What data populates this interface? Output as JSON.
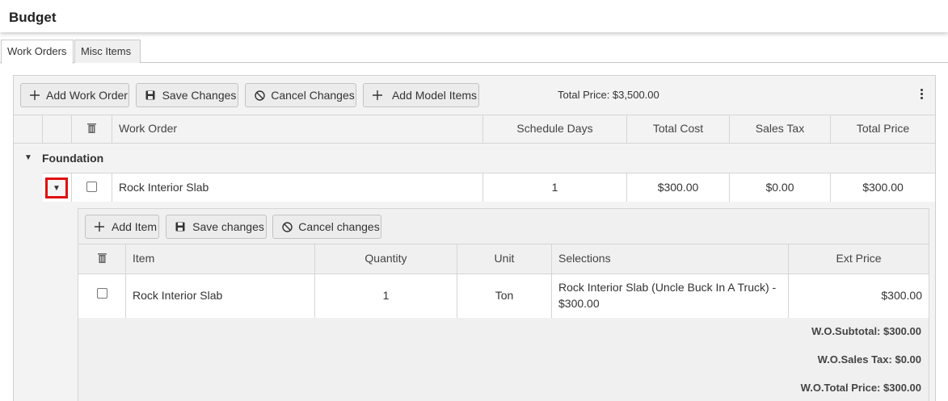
{
  "header": {
    "title": "Budget"
  },
  "tabs": [
    {
      "label": "Work Orders",
      "active": true
    },
    {
      "label": "Misc Items",
      "active": false
    }
  ],
  "toolbar": {
    "add_work_order": "Add Work Order",
    "save_changes": "Save Changes",
    "cancel_changes": "Cancel Changes",
    "add_model_items": "Add Model Items",
    "total_price": "Total Price: $3,500.00"
  },
  "columns": {
    "work_order": "Work Order",
    "schedule_days": "Schedule Days",
    "total_cost": "Total Cost",
    "sales_tax": "Sales Tax",
    "total_price": "Total Price"
  },
  "group": {
    "name": "Foundation"
  },
  "work_order_row": {
    "name": "Rock Interior Slab",
    "schedule_days": "1",
    "total_cost": "$300.00",
    "sales_tax": "$0.00",
    "total_price": "$300.00"
  },
  "detail": {
    "toolbar": {
      "add_item": "Add Item",
      "save_changes": "Save changes",
      "cancel_changes": "Cancel changes"
    },
    "columns": {
      "item": "Item",
      "quantity": "Quantity",
      "unit": "Unit",
      "selections": "Selections",
      "ext_price": "Ext Price"
    },
    "row": {
      "item": "Rock Interior Slab",
      "quantity": "1",
      "unit": "Ton",
      "selections_line1": "Rock Interior Slab (Uncle Buck In A Truck) -",
      "selections_line2": "$300.00",
      "ext_price": "$300.00"
    },
    "totals": {
      "subtotal": "W.O.Subtotal: $300.00",
      "sales_tax": "W.O.Sales Tax: $0.00",
      "total_price": "W.O.Total Price: $300.00"
    }
  },
  "colors": {
    "highlight_border": "#e01010",
    "grid_bg": "#f3f3f3",
    "border": "#d5d5d5"
  }
}
